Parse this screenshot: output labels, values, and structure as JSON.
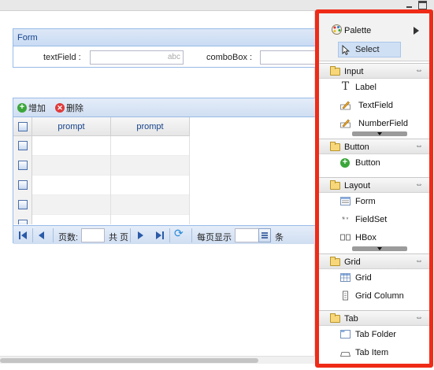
{
  "form": {
    "title": "Form",
    "textfield_label": "textField :",
    "textfield_placeholder": "abc",
    "combobox_label": "comboBox :"
  },
  "grid": {
    "toolbar": {
      "add_label": "增加",
      "delete_label": "删除"
    },
    "columns": [
      "prompt",
      "prompt"
    ],
    "row_count": 5
  },
  "pager": {
    "page_label": "页数:",
    "total_label": "共 页",
    "per_page_label": "每页显示",
    "unit_label": "条"
  },
  "palette": {
    "title": "Palette",
    "select_label": "Select",
    "groups": [
      {
        "label": "Input",
        "items": [
          {
            "label": "Label",
            "icon": "label-icon"
          },
          {
            "label": "TextField",
            "icon": "textfield-icon"
          },
          {
            "label": "NumberField",
            "icon": "numberfield-icon"
          }
        ]
      },
      {
        "label": "Button",
        "items": [
          {
            "label": "Button",
            "icon": "button-icon"
          }
        ]
      },
      {
        "label": "Layout",
        "items": [
          {
            "label": "Form",
            "icon": "form-icon"
          },
          {
            "label": "FieldSet",
            "icon": "fieldset-icon"
          },
          {
            "label": "HBox",
            "icon": "hbox-icon"
          }
        ]
      },
      {
        "label": "Grid",
        "items": [
          {
            "label": "Grid",
            "icon": "grid-icon"
          },
          {
            "label": "Grid Column",
            "icon": "grid-column-icon"
          }
        ]
      },
      {
        "label": "Tab",
        "items": [
          {
            "label": "Tab Folder",
            "icon": "tab-folder-icon"
          },
          {
            "label": "Tab Item",
            "icon": "tab-item-icon"
          }
        ]
      }
    ]
  },
  "colors": {
    "highlight_border": "#ef2b18",
    "panel_header": "#c9dbf3",
    "panel_border": "#99bbe8",
    "select_bg": "#cfe0f5"
  }
}
